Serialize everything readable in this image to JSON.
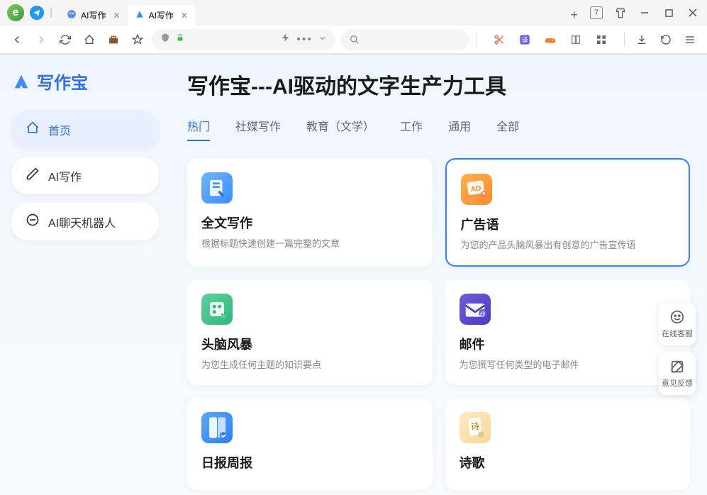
{
  "browser": {
    "tabs": [
      {
        "label": "AI写作",
        "active": false
      },
      {
        "label": "AI写作",
        "active": true
      }
    ],
    "counter": "7"
  },
  "app": {
    "brand": "写作宝",
    "title": "写作宝---AI驱动的文字生产力工具",
    "nav": [
      {
        "label": "首页",
        "icon": "home",
        "active": true
      },
      {
        "label": "AI写作",
        "icon": "pen",
        "active": false
      },
      {
        "label": "AI聊天机器人",
        "icon": "chat",
        "active": false
      }
    ],
    "content_tabs": [
      {
        "label": "热门",
        "active": true
      },
      {
        "label": "社媒写作",
        "active": false
      },
      {
        "label": "教育（文学）",
        "active": false
      },
      {
        "label": "工作",
        "active": false
      },
      {
        "label": "通用",
        "active": false
      },
      {
        "label": "全部",
        "active": false
      }
    ],
    "cards": [
      {
        "title": "全文写作",
        "desc": "根据标题快速创建一篇完整的文章",
        "icon": "doc-edit",
        "cls": "ic-blue",
        "highlighted": false
      },
      {
        "title": "广告语",
        "desc": "为您的产品头脑风暴出有创意的广告宣传语",
        "icon": "ad",
        "cls": "ic-orange",
        "highlighted": true
      },
      {
        "title": "头脑风暴",
        "desc": "为您生成任何主题的知识要点",
        "icon": "brain",
        "cls": "ic-green",
        "highlighted": false
      },
      {
        "title": "邮件",
        "desc": "为您撰写任何类型的电子邮件",
        "icon": "mail",
        "cls": "ic-purple",
        "highlighted": false
      },
      {
        "title": "日报周报",
        "desc": "",
        "icon": "report",
        "cls": "ic-lblue",
        "highlighted": false
      },
      {
        "title": "诗歌",
        "desc": "",
        "icon": "poem",
        "cls": "ic-paper",
        "highlighted": false
      }
    ],
    "float": [
      {
        "label": "在线客服",
        "icon": "service"
      },
      {
        "label": "意见反馈",
        "icon": "feedback"
      }
    ]
  }
}
